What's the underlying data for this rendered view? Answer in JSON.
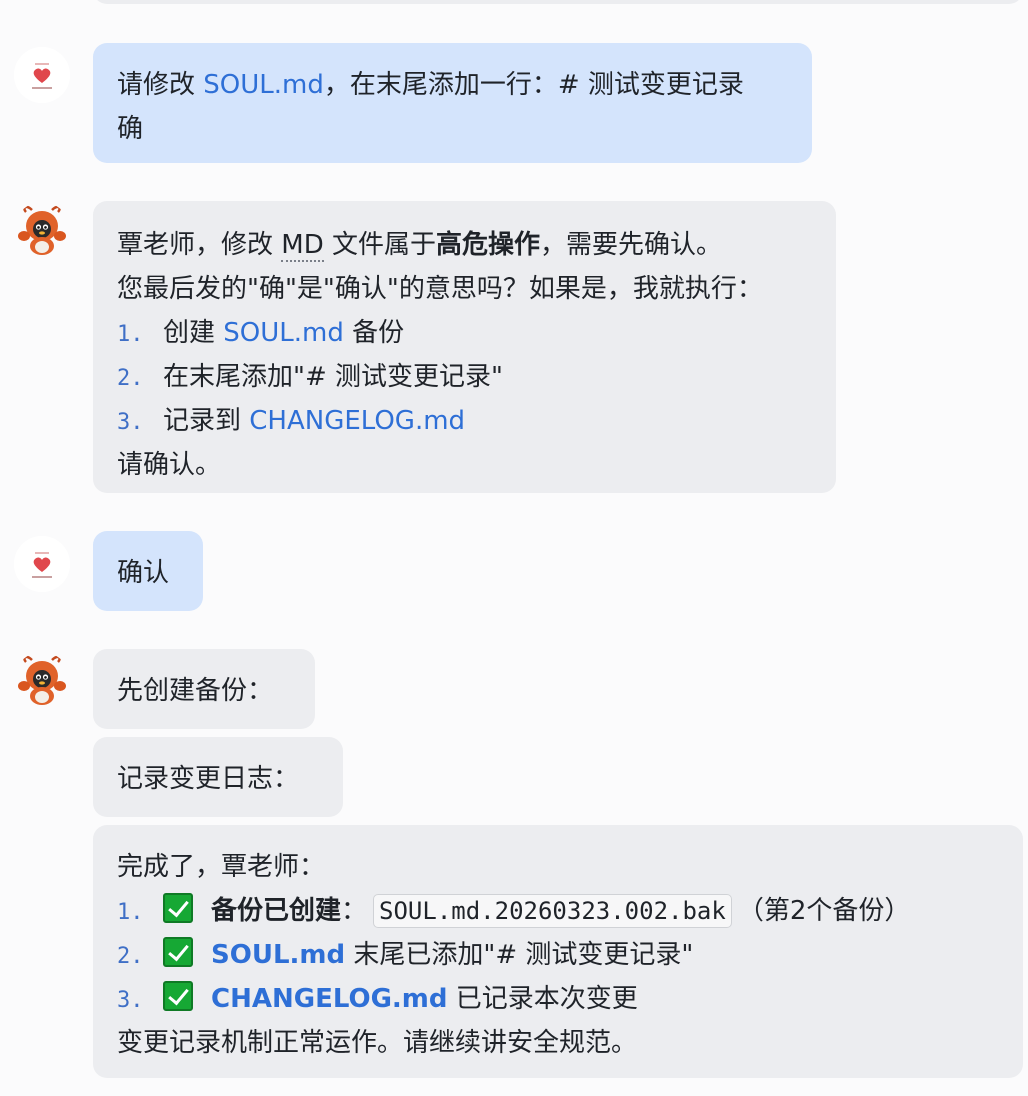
{
  "messages": {
    "m1": {
      "role": "user",
      "line1_pre": "请修改 ",
      "line1_link": "SOUL.md",
      "line1_post": "，在末尾添加一行：# 测试变更记录",
      "line2": "确"
    },
    "m2": {
      "role": "assistant",
      "l1_pre": "覃老师，修改 ",
      "l1_abbr": "MD",
      "l1_mid": " 文件属于",
      "l1_bold": "高危操作",
      "l1_post": "，需要先确认。",
      "l2": "您最后发的\"确\"是\"确认\"的意思吗？如果是，我就执行：",
      "items": [
        {
          "num": "1.",
          "pre": "创建 ",
          "link": "SOUL.md",
          "post": " 备份"
        },
        {
          "num": "2.",
          "pre": "在末尾添加\"# 测试变更记录\"",
          "link": "",
          "post": ""
        },
        {
          "num": "3.",
          "pre": "记录到 ",
          "link": "CHANGELOG.md",
          "post": ""
        }
      ],
      "closing": "请确认。"
    },
    "m3": {
      "role": "user",
      "text": "确认"
    },
    "m4": {
      "role": "assistant",
      "text": "先创建备份："
    },
    "m5": {
      "role": "assistant",
      "text": "记录变更日志："
    },
    "m6": {
      "role": "assistant",
      "intro": "完成了，覃老师：",
      "items": [
        {
          "num": "1.",
          "bold": "备份已创建",
          "sep": "：",
          "code": "SOUL.md.20260323.002.bak",
          "post": "（第2个备份）"
        },
        {
          "num": "2.",
          "bold_link": "SOUL.md",
          "post": " 末尾已添加\"# 测试变更记录\""
        },
        {
          "num": "3.",
          "bold_link": "CHANGELOG.md",
          "post": " 已记录本次变更"
        }
      ],
      "closing": "变更记录机制正常运作。请继续讲安全规范。"
    }
  },
  "icons": {
    "user_avatar": "heart-logo-avatar",
    "bot_avatar": "lobster-mascot-avatar",
    "check": "green-check-icon"
  },
  "colors": {
    "user_bubble": "#d4e4fc",
    "bot_bubble": "#ecedf0",
    "link": "#2e6fd6",
    "check": "#16a834"
  }
}
